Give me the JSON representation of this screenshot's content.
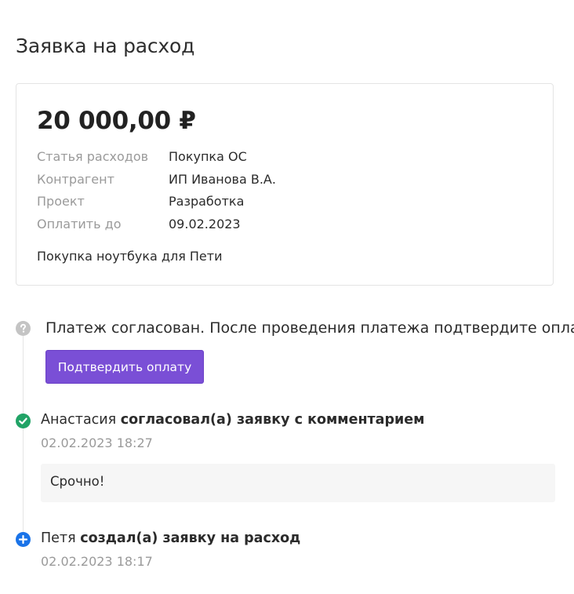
{
  "page": {
    "title": "Заявка на расход"
  },
  "request": {
    "amount": "20 000,00 ₽",
    "details": [
      {
        "label": "Статья расходов",
        "value": "Покупка ОС"
      },
      {
        "label": "Контрагент",
        "value": "ИП Иванова В.А."
      },
      {
        "label": "Проект",
        "value": "Разработка"
      },
      {
        "label": "Оплатить до",
        "value": "09.02.2023"
      }
    ],
    "description": "Покупка ноутбука для Пети"
  },
  "status": {
    "icon": "question-icon",
    "text": "Платеж согласован. После проведения платежа подтвердите оплату.",
    "button_label": "Подтвердить оплату"
  },
  "history": [
    {
      "icon": "check-circle-icon",
      "author": "Анастасия",
      "action": "согласовал(а) заявку с комментарием",
      "time": "02.02.2023 18:27",
      "comment": "Срочно!"
    },
    {
      "icon": "plus-circle-icon",
      "author": "Петя",
      "action": "создал(а) заявку на расход",
      "time": "02.02.2023 18:17"
    }
  ],
  "colors": {
    "accent": "#7a4fd6",
    "success": "#21a366",
    "info": "#1a73e8",
    "muted": "#9a9a9a"
  }
}
